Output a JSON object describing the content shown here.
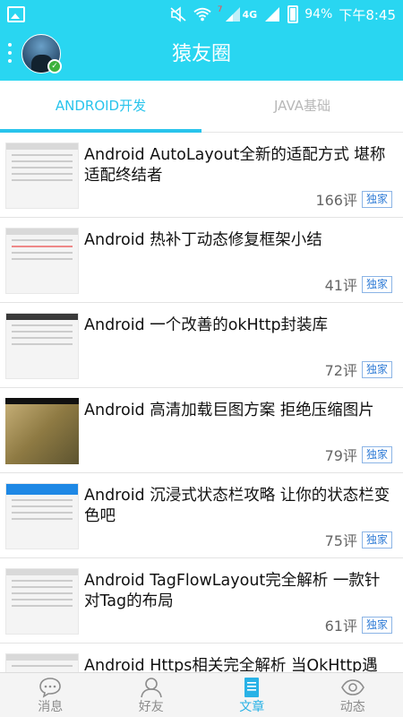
{
  "status_bar": {
    "notification_icon": "gallery-icon",
    "icons": [
      "mute-icon",
      "wifi-icon",
      "signal-4g-icon",
      "signal-icon",
      "battery-charging-icon"
    ],
    "sim_label": "4G",
    "sim_slot": "7",
    "battery_percent": "94%",
    "time": "下午8:45"
  },
  "app_bar": {
    "title": "猿友圈",
    "menu_icon": "more-vertical-icon",
    "avatar_icon": "avatar",
    "verified_icon": "check-badge-icon"
  },
  "tabs": [
    {
      "label": "ANDROID开发",
      "active": true
    },
    {
      "label": "JAVA基础",
      "active": false
    }
  ],
  "articles": [
    {
      "title": "Android AutoLayout全新的适配方式 堪称适配终结者",
      "comments": "166评",
      "badge": "独家"
    },
    {
      "title": "Android 热补丁动态修复框架小结",
      "comments": "41评",
      "badge": "独家"
    },
    {
      "title": "Android 一个改善的okHttp封装库",
      "comments": "72评",
      "badge": "独家"
    },
    {
      "title": "Android 高清加载巨图方案 拒绝压缩图片",
      "comments": "79评",
      "badge": "独家"
    },
    {
      "title": "Android 沉浸式状态栏攻略 让你的状态栏变色吧",
      "comments": "75评",
      "badge": "独家"
    },
    {
      "title": "Android TagFlowLayout完全解析 一款针对Tag的布局",
      "comments": "61评",
      "badge": "独家"
    },
    {
      "title": "Android Https相关完全解析 当OkHttp遇",
      "comments": "",
      "badge": ""
    }
  ],
  "bottom_nav": [
    {
      "label": "消息",
      "icon": "chat-bubble-icon",
      "active": false
    },
    {
      "label": "好友",
      "icon": "person-icon",
      "active": false
    },
    {
      "label": "文章",
      "icon": "document-icon",
      "active": true
    },
    {
      "label": "动态",
      "icon": "eye-icon",
      "active": false
    }
  ],
  "colors": {
    "primary": "#29d6f1",
    "tab_active": "#29c4ec",
    "badge": "#2e7bd6",
    "nav_active": "#29b2e6"
  }
}
